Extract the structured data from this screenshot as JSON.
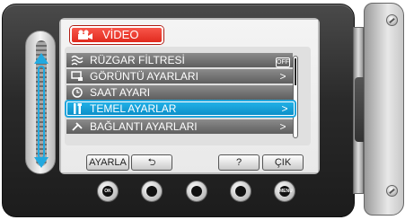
{
  "menu": {
    "title": "VİDEO",
    "items": [
      {
        "label": "RÜZGAR FİLTRESİ",
        "icon": "wind-filter-icon",
        "trail": "OFF"
      },
      {
        "label": "GÖRÜNTÜ AYARLARI",
        "icon": "display-settings-icon",
        "trail": ">"
      },
      {
        "label": "SAAT AYARI",
        "icon": "clock-icon",
        "trail": ""
      },
      {
        "label": "TEMEL AYARLAR",
        "icon": "tools-icon",
        "trail": ">"
      },
      {
        "label": "BAĞLANTI AYARLARI",
        "icon": "connection-icon",
        "trail": ">"
      }
    ]
  },
  "soft_buttons": {
    "set": "AYARLA",
    "back": "⮌",
    "help": "?",
    "exit": "ÇIK"
  },
  "hw_buttons": {
    "ok": "OK",
    "menu": "MENU"
  },
  "colors": {
    "accent": "#23a9df",
    "menu_tab": "#e12a1e",
    "row": "#707070"
  }
}
